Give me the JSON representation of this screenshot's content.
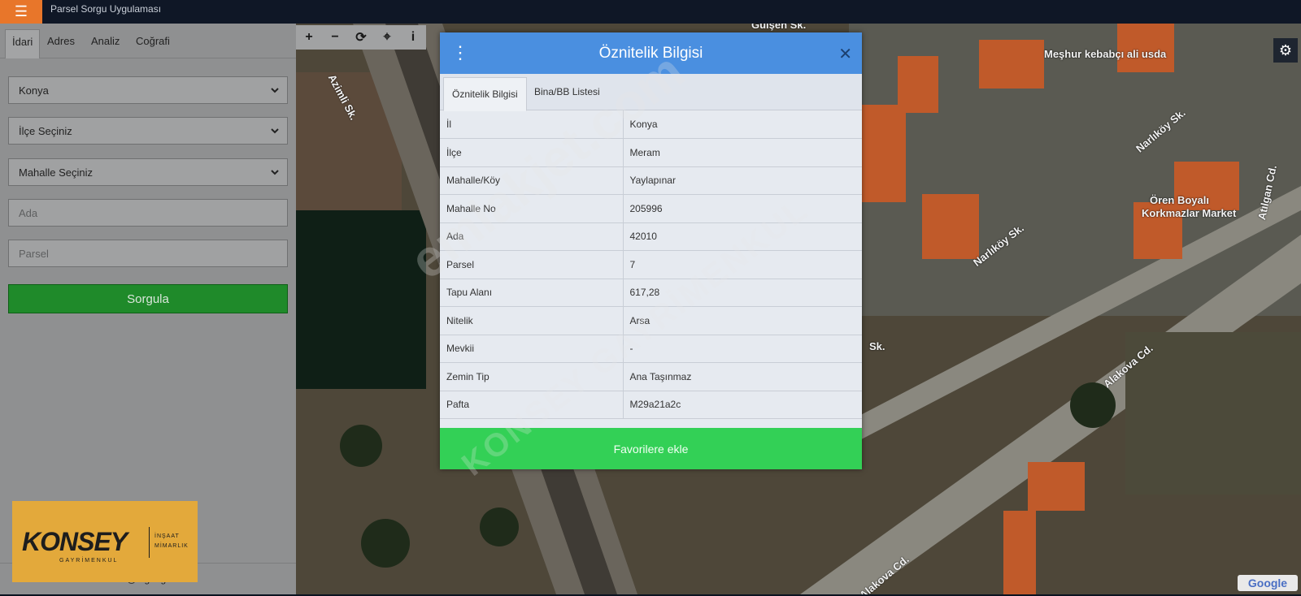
{
  "header": {
    "menu_icon": "hamburger-icon",
    "app_title": "Parsel Sorgu Uygulaması"
  },
  "sidebar": {
    "tabs": [
      "İdari",
      "Adres",
      "Analiz",
      "Coğrafi"
    ],
    "province_select": "Konya",
    "district_select": "İlçe Seçiniz",
    "neighborhood_select": "Mahalle Seçiniz",
    "ada_placeholder": "Ada",
    "parsel_placeholder": "Parsel",
    "query_button": "Sorgula",
    "footer_email": "cbs@tkgm.gov.tr"
  },
  "map": {
    "toolbar": [
      "+",
      "−",
      "⟳",
      "⌖",
      "i"
    ],
    "streets": [
      "Gülşen Sk.",
      "Azimli Sk.",
      "Narlıköy Sk.",
      "Narlıköy Sk.",
      "Atılgan Cd.",
      "Alakova Cd.",
      "Alakova Cd.",
      "Sk."
    ],
    "pois": [
      "Meşhur kebabçı ali usda",
      "Ören Boyalı",
      "Korkmazlar Market"
    ],
    "attribution": "Google"
  },
  "modal": {
    "title": "Öznitelik Bilgisi",
    "tabs": [
      "Öznitelik Bilgisi",
      "Bina/BB Listesi"
    ],
    "rows": [
      {
        "key": "İl",
        "value": "Konya"
      },
      {
        "key": "İlçe",
        "value": "Meram"
      },
      {
        "key": "Mahalle/Köy",
        "value": "Yaylapınar"
      },
      {
        "key": "Mahalle No",
        "value": "205996"
      },
      {
        "key": "Ada",
        "value": "42010"
      },
      {
        "key": "Parsel",
        "value": "7"
      },
      {
        "key": "Tapu Alanı",
        "value": "617,28"
      },
      {
        "key": "Nitelik",
        "value": "Arsa"
      },
      {
        "key": "Mevkii",
        "value": "-"
      },
      {
        "key": "Zemin Tip",
        "value": "Ana Taşınmaz"
      },
      {
        "key": "Pafta",
        "value": "M29a21a2c"
      }
    ],
    "favorite_button": "Favorilere ekle"
  },
  "watermark": {
    "line1": "emlakjet.com",
    "line2": "KONSEY GAYRİMENKUL"
  },
  "logo": {
    "main": "KONSEY",
    "sub": "GAYRİMENKUL",
    "right1": "İNŞAAT",
    "right2": "MİMARLIK"
  },
  "colors": {
    "menu_accent": "#e8762a",
    "modal_header": "#4a8fe0",
    "query_button": "#1f8a2a",
    "favorite_button": "#33d056"
  }
}
